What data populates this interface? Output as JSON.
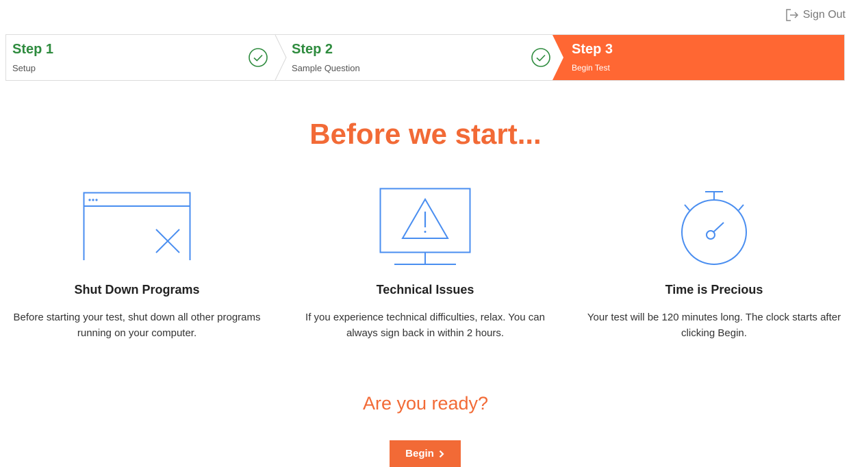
{
  "header": {
    "signout_label": "Sign Out",
    "signout_icon": "sign-out-icon"
  },
  "steps": [
    {
      "title": "Step 1",
      "subtitle": "Setup",
      "status": "complete"
    },
    {
      "title": "Step 2",
      "subtitle": "Sample Question",
      "status": "complete"
    },
    {
      "title": "Step 3",
      "subtitle": "Begin Test",
      "status": "active"
    }
  ],
  "main": {
    "headline": "Before we start...",
    "cards": [
      {
        "icon": "browser-window-close-icon",
        "title": "Shut Down Programs",
        "description": "Before starting your test, shut down all other programs running on your computer."
      },
      {
        "icon": "monitor-warning-icon",
        "title": "Technical Issues",
        "description": "If you experience technical difficulties, relax. You can always sign back in within 2 hours."
      },
      {
        "icon": "stopwatch-icon",
        "title": "Time is Precious",
        "description": "Your test will be 120 minutes long. The clock starts after clicking Begin."
      }
    ],
    "ready_text": "Are you ready?",
    "begin_label": "Begin",
    "begin_icon": "chevron-right-icon"
  },
  "colors": {
    "accent": "#f26a36",
    "complete": "#2e8b3e",
    "icon_blue": "#4a8ef0"
  }
}
